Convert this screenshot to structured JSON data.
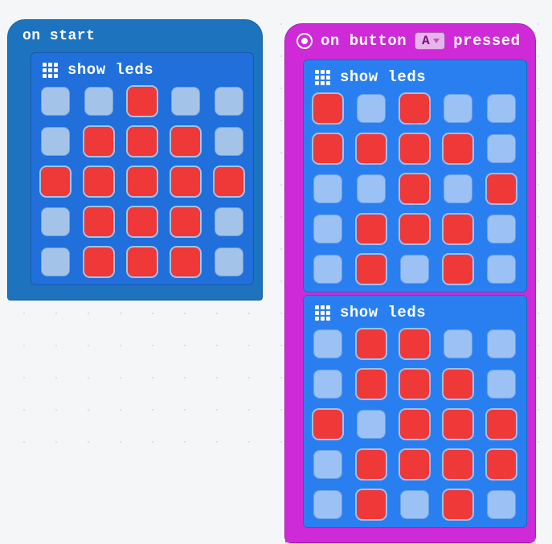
{
  "colors": {
    "hat_onstart": "#1e73be",
    "hat_event": "#cf2ad7",
    "showleds": "#206fda",
    "led_on": "#ef3838",
    "led_off": "#a4c3e9"
  },
  "blocks": {
    "on_start": {
      "label": "on start",
      "kind": "hat",
      "children": [
        {
          "type": "show_leds",
          "label": "show leds",
          "grid": [
            [
              0,
              0,
              1,
              0,
              0
            ],
            [
              0,
              1,
              1,
              1,
              0
            ],
            [
              1,
              1,
              1,
              1,
              1
            ],
            [
              0,
              1,
              1,
              1,
              0
            ],
            [
              0,
              1,
              1,
              1,
              0
            ]
          ]
        }
      ]
    },
    "on_button_pressed": {
      "prefix_label": "on button",
      "suffix_label": "pressed",
      "dropdown_value": "A",
      "kind": "hat-event",
      "children": [
        {
          "type": "show_leds",
          "label": "show leds",
          "grid": [
            [
              1,
              0,
              1,
              0,
              0
            ],
            [
              1,
              1,
              1,
              1,
              0
            ],
            [
              0,
              0,
              1,
              0,
              1
            ],
            [
              0,
              1,
              1,
              1,
              0
            ],
            [
              0,
              1,
              0,
              1,
              0
            ]
          ]
        },
        {
          "type": "show_leds",
          "label": "show leds",
          "grid": [
            [
              0,
              1,
              1,
              0,
              0
            ],
            [
              0,
              1,
              1,
              1,
              0
            ],
            [
              1,
              0,
              1,
              1,
              1
            ],
            [
              0,
              1,
              1,
              1,
              1
            ],
            [
              0,
              1,
              0,
              1,
              0
            ]
          ]
        }
      ]
    }
  }
}
